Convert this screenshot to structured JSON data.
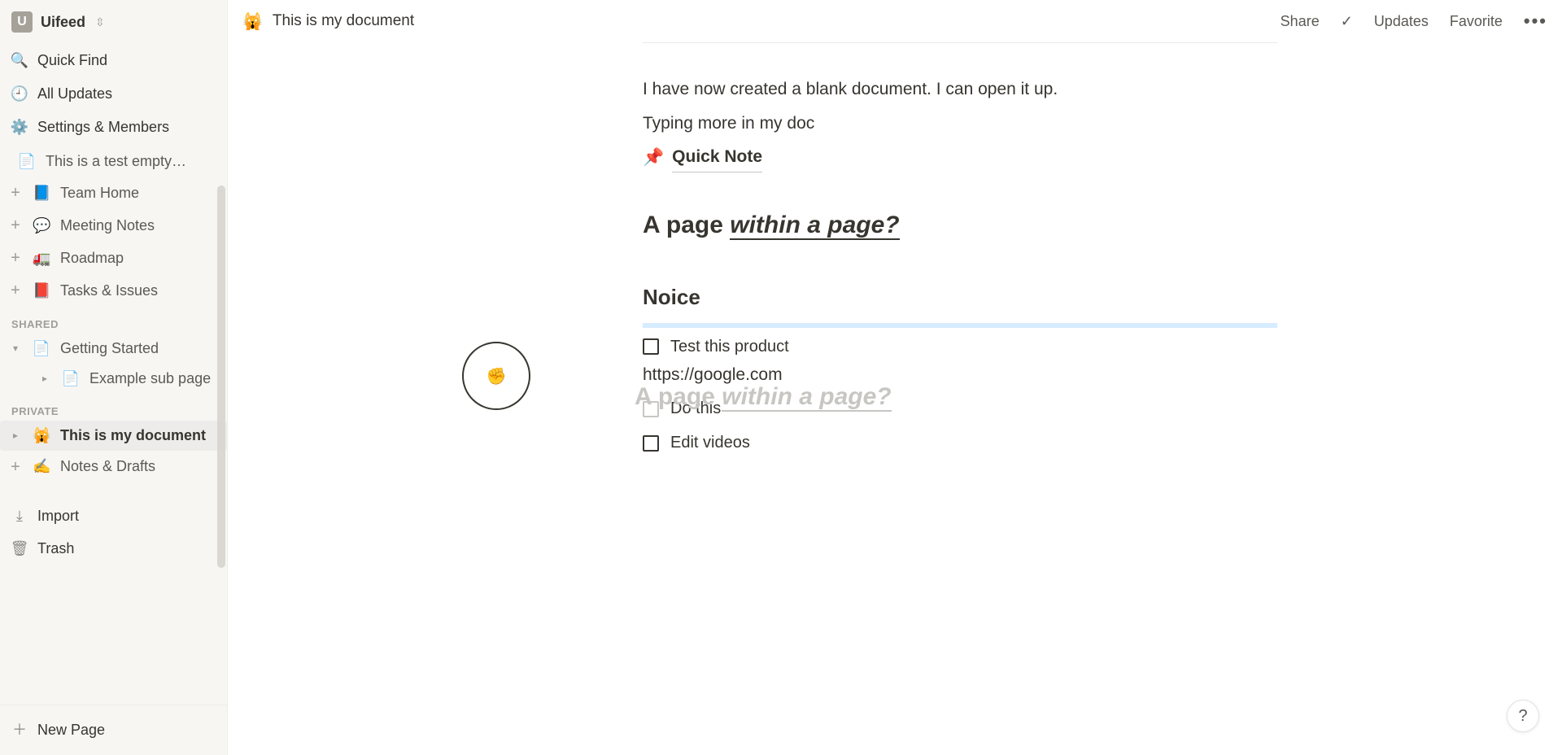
{
  "workspace": {
    "initial": "U",
    "name": "Uifeed"
  },
  "nav": {
    "quick_find": "Quick Find",
    "all_updates": "All Updates",
    "settings": "Settings & Members"
  },
  "tree": {
    "truncated": "This is a test empty…",
    "items": [
      {
        "icon": "📘",
        "label": "Team Home"
      },
      {
        "icon": "💬",
        "label": "Meeting Notes"
      },
      {
        "icon": "🚛",
        "label": "Roadmap"
      },
      {
        "icon": "📕",
        "label": "Tasks & Issues"
      }
    ]
  },
  "shared": {
    "header": "SHARED",
    "root": {
      "label": "Getting Started"
    },
    "child": {
      "label": "Example sub page"
    }
  },
  "private": {
    "header": "PRIVATE",
    "items": [
      {
        "icon": "🙀",
        "label": "This is my document",
        "active": true
      },
      {
        "icon": "✍️",
        "label": "Notes & Drafts",
        "active": false
      }
    ]
  },
  "footer": {
    "import": "Import",
    "trash": "Trash",
    "new_page": "New Page"
  },
  "topbar": {
    "icon": "🙀",
    "title": "This is my document",
    "share": "Share",
    "updates": "Updates",
    "favorite": "Favorite"
  },
  "doc": {
    "p1": "I have now created a blank document. I can open it up.",
    "p2": "Typing more in my doc",
    "quicknote": {
      "icon": "📌",
      "label": "Quick Note"
    },
    "heading_a": "A page ",
    "heading_b": "within a page?",
    "sub": "Noice",
    "todos": [
      "Test this product",
      "Do this",
      "Edit videos"
    ],
    "link": "https://google.com",
    "ghost_a": "A page ",
    "ghost_b": "within a page?"
  },
  "help": "?"
}
